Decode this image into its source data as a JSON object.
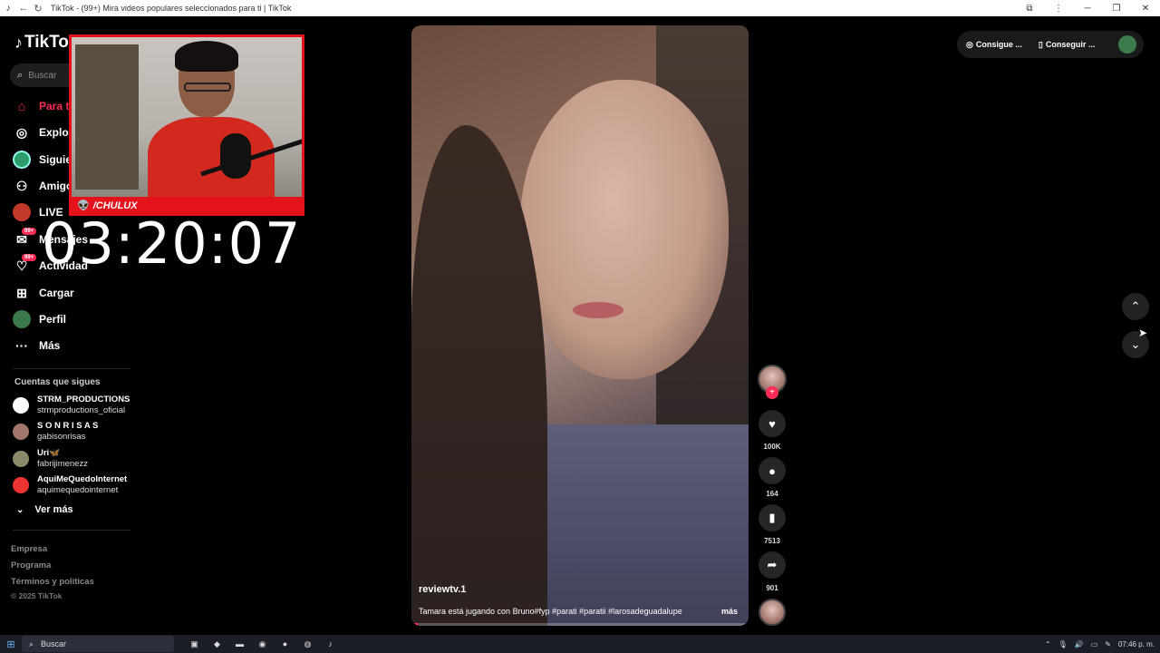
{
  "window": {
    "title": "TikTok - (99+) Mira videos populares seleccionados para ti | TikTok",
    "icons": [
      "tiktok-icon",
      "back-icon",
      "reload-icon",
      "extensions-icon",
      "more-icon",
      "minimize-icon",
      "restore-icon",
      "close-icon"
    ]
  },
  "sidebar": {
    "logo": "TikTok",
    "search_placeholder": "Buscar",
    "nav": [
      {
        "label": "Para ti",
        "icon": "home-icon",
        "active": true
      },
      {
        "label": "Explorar",
        "icon": "compass-icon"
      },
      {
        "label": "Siguiendo",
        "icon": "following-avatar-icon"
      },
      {
        "label": "Amigos",
        "icon": "friends-icon"
      },
      {
        "label": "LIVE",
        "icon": "live-icon"
      },
      {
        "label": "Mensajes",
        "icon": "message-icon",
        "badge": "99+"
      },
      {
        "label": "Actividad",
        "icon": "activity-icon",
        "badge": "99+"
      },
      {
        "label": "Cargar",
        "icon": "upload-icon"
      },
      {
        "label": "Perfil",
        "icon": "profile-icon"
      },
      {
        "label": "Más",
        "icon": "more-dots-icon"
      }
    ],
    "following_title": "Cuentas que sigues",
    "following": [
      {
        "name": "STRM_PRODUCTIONS",
        "handle": "strmproductions_oficial"
      },
      {
        "name": "S O N R I S A S",
        "handle": "gabisonrisas"
      },
      {
        "name": "Uri🦋",
        "handle": "fabrijimenezz"
      },
      {
        "name": "AquiMeQuedoInternet",
        "handle": "aquimequedointernet"
      }
    ],
    "see_more": "Ver más",
    "footer_links": [
      "Empresa",
      "Programa",
      "Términos y políticas"
    ],
    "copyright": "© 2025 TikTok"
  },
  "overlay": {
    "streamer_name": "/CHULUX",
    "timer": "03:20:07"
  },
  "video": {
    "author": "reviewtv.1",
    "caption": "Tamara está jugando con Bruno#fyp #parati #paratii #larosadeguadalupe",
    "more": "más",
    "progress": 0.02
  },
  "actions": {
    "likes": "100K",
    "comments": "164",
    "saves": "7513",
    "shares": "901"
  },
  "topbar": {
    "coins": "Consigue ...",
    "app": "Conseguir ..."
  },
  "taskbar": {
    "search_placeholder": "Buscar",
    "time": "07:46 p. m."
  },
  "colors": {
    "accent": "#fe2c55",
    "background": "#000000",
    "overlay_frame": "#e4121b"
  }
}
